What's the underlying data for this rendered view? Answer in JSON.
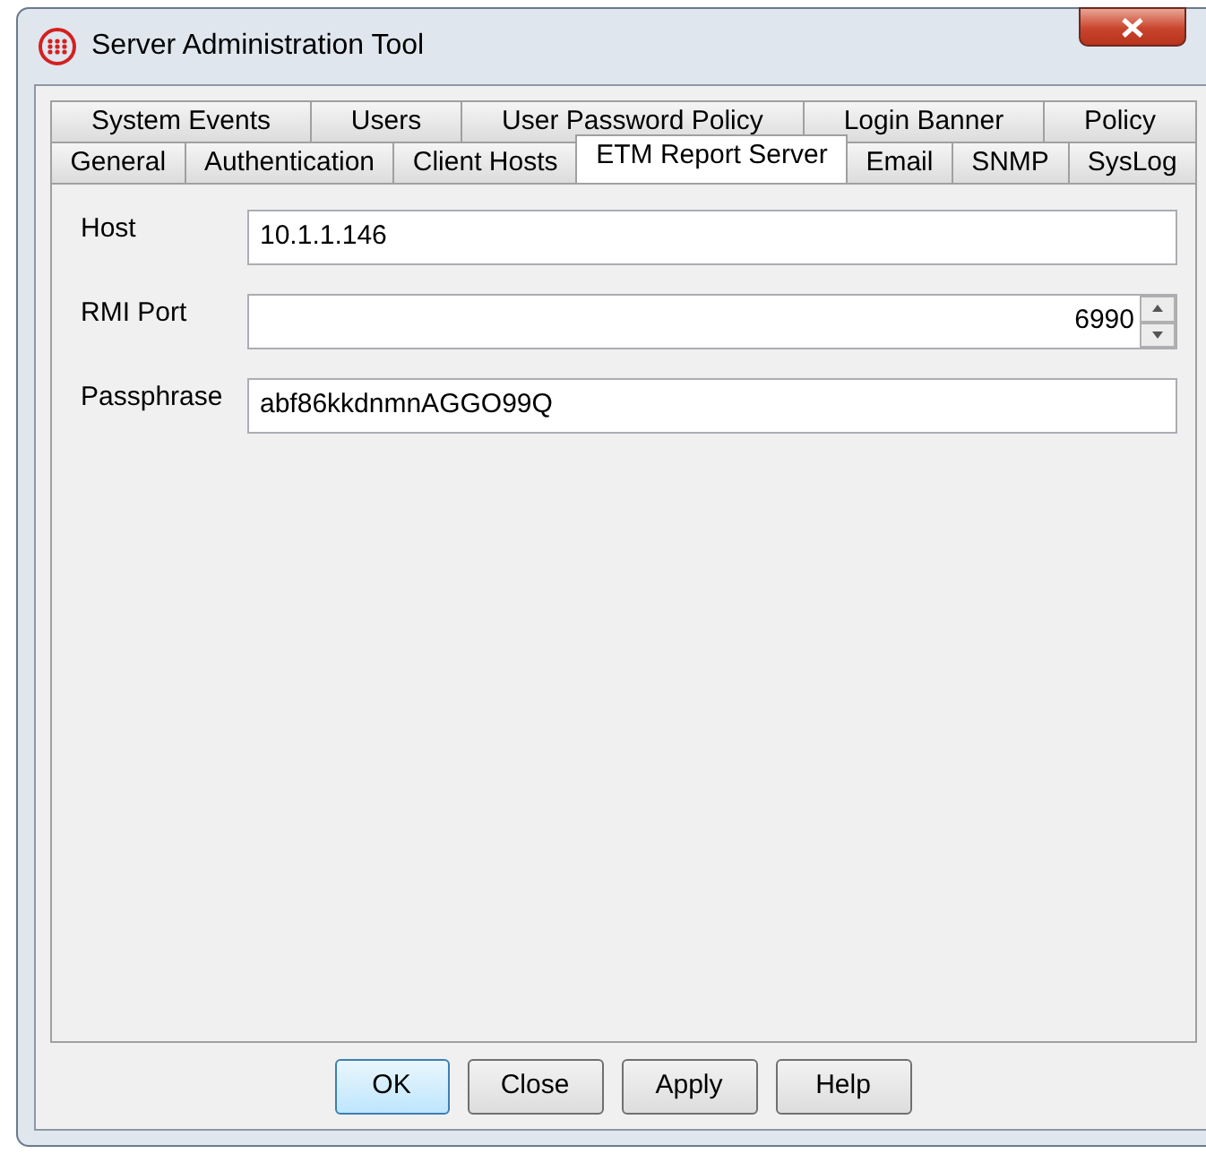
{
  "window": {
    "title": "Server Administration Tool"
  },
  "tab_rows": [
    [
      {
        "label": "System Events",
        "selected": false
      },
      {
        "label": "Users",
        "selected": false
      },
      {
        "label": "User Password Policy",
        "selected": false
      },
      {
        "label": "Login Banner",
        "selected": false
      },
      {
        "label": "Policy",
        "selected": false
      }
    ],
    [
      {
        "label": "General",
        "selected": false
      },
      {
        "label": "Authentication",
        "selected": false
      },
      {
        "label": "Client Hosts",
        "selected": false
      },
      {
        "label": "ETM Report Server",
        "selected": true
      },
      {
        "label": "Email",
        "selected": false
      },
      {
        "label": "SNMP",
        "selected": false
      },
      {
        "label": "SysLog",
        "selected": false
      }
    ]
  ],
  "fields": [
    {
      "label": "Host",
      "value": "10.1.1.146",
      "kind": "text"
    },
    {
      "label": "RMI Port",
      "value": "6990",
      "kind": "spinner"
    },
    {
      "label": "Passphrase",
      "value": "abf86kkdnmnAGGO99Q",
      "kind": "text"
    }
  ],
  "buttons": [
    {
      "label": "OK",
      "default": true
    },
    {
      "label": "Close",
      "default": false
    },
    {
      "label": "Apply",
      "default": false
    },
    {
      "label": "Help",
      "default": false
    }
  ]
}
